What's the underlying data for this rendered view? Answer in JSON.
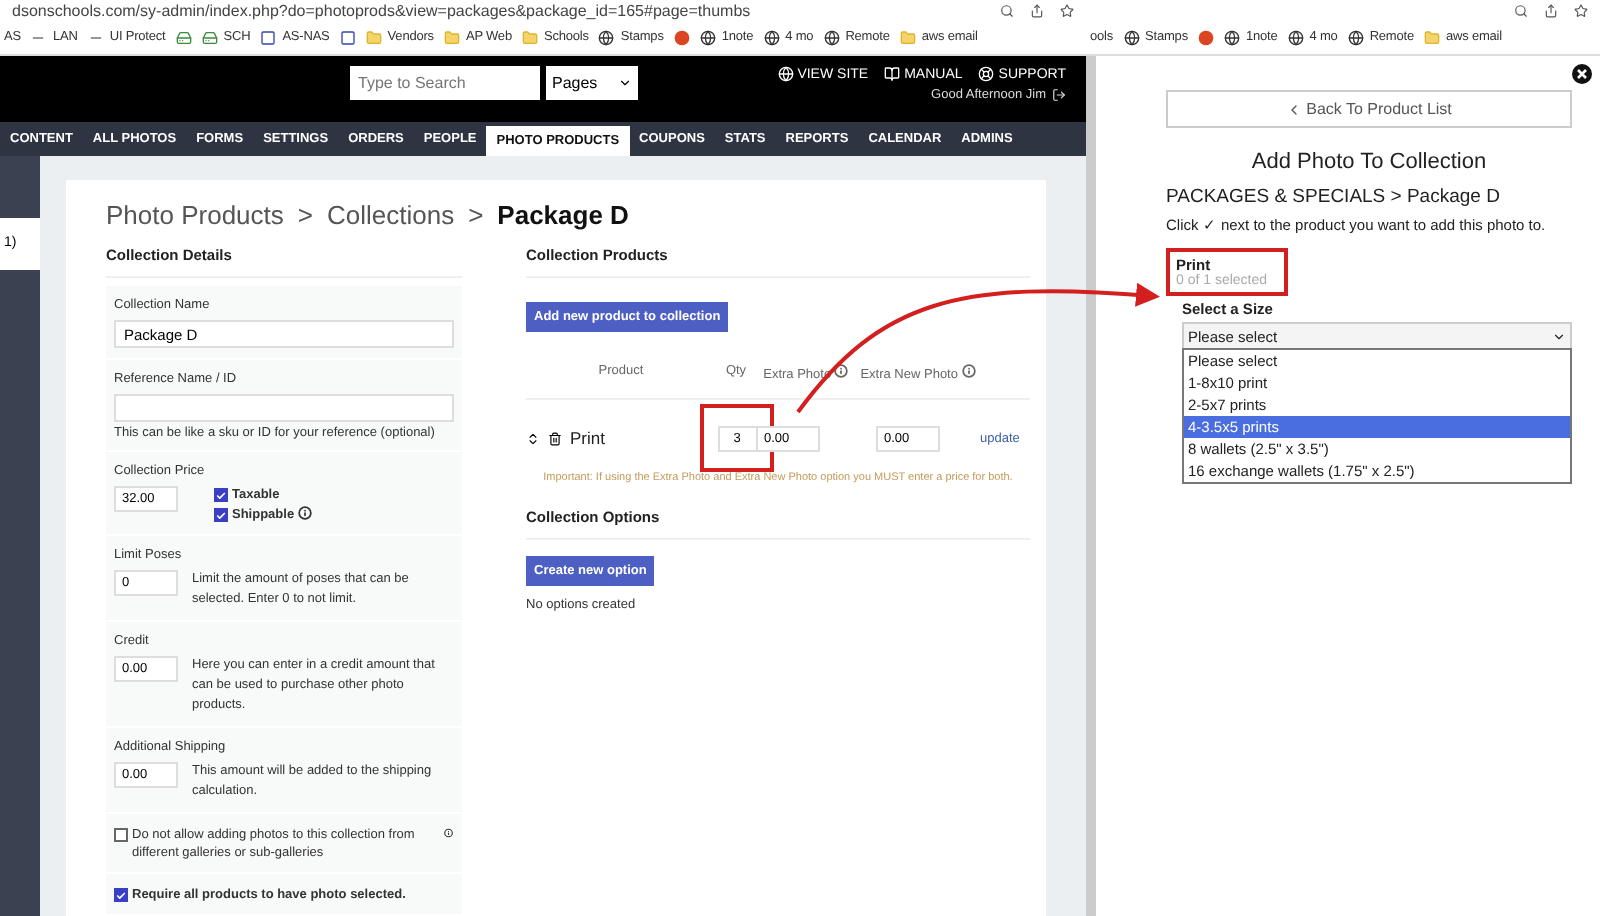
{
  "left_browser": {
    "url": "dsonschools.com/sy-admin/index.php?do=photoprods&view=packages&package_id=165#page=thumbs",
    "bookmarks": [
      {
        "kind": "plain",
        "label": "AS"
      },
      {
        "kind": "line",
        "label": "LAN"
      },
      {
        "kind": "line",
        "label": "UI Protect"
      },
      {
        "kind": "drive"
      },
      {
        "kind": "drive",
        "label": "SCH"
      },
      {
        "kind": "box",
        "label": "AS-NAS"
      },
      {
        "kind": "box"
      },
      {
        "kind": "folder",
        "label": "Vendors"
      },
      {
        "kind": "folder",
        "label": "AP Web"
      },
      {
        "kind": "folder",
        "label": "Schools"
      },
      {
        "kind": "site",
        "label": "Stamps"
      },
      {
        "kind": "dot"
      },
      {
        "kind": "site",
        "label": "1note"
      },
      {
        "kind": "site",
        "label": "4 mo"
      },
      {
        "kind": "site",
        "label": "Remote"
      },
      {
        "kind": "folder",
        "label": "aws email"
      }
    ],
    "header": {
      "search": {
        "placeholder": "Type to Search"
      },
      "scope": "Pages",
      "links": [
        {
          "kind": "globe",
          "label": "VIEW SITE"
        },
        {
          "kind": "book",
          "label": "MANUAL"
        },
        {
          "kind": "help",
          "label": "SUPPORT"
        }
      ],
      "greeting": "Good Afternoon Jim"
    },
    "nav": [
      {
        "label": "CONTENT",
        "selected": false
      },
      {
        "label": "ALL PHOTOS",
        "selected": false
      },
      {
        "label": "FORMS",
        "selected": false
      },
      {
        "label": "SETTINGS",
        "selected": false
      },
      {
        "label": "ORDERS",
        "selected": false
      },
      {
        "label": "PEOPLE",
        "selected": false
      },
      {
        "label": "PHOTO PRODUCTS",
        "selected": true
      },
      {
        "label": "COUPONS",
        "selected": false
      },
      {
        "label": "STATS",
        "selected": false
      },
      {
        "label": "REPORTS",
        "selected": false
      },
      {
        "label": "CALENDAR",
        "selected": false
      },
      {
        "label": "ADMINS",
        "selected": false
      }
    ],
    "sidebar_fragment": "1)",
    "breadcrumb": {
      "items": [
        "Photo Products",
        "Collections",
        "Package D"
      ],
      "separator": ">"
    },
    "details": {
      "title": "Collection Details",
      "fields": [
        {
          "kind": "text",
          "label": "Collection Name",
          "value": "Package D"
        },
        {
          "kind": "text",
          "label": "Reference Name / ID",
          "hint": "This can be like a sku or ID for your reference (optional)"
        },
        {
          "kind": "price",
          "label": "Collection Price",
          "value": "32.00",
          "options": [
            {
              "label": "Taxable",
              "checked": true,
              "info": false
            },
            {
              "label": "Shippable",
              "checked": true,
              "info": true
            }
          ]
        },
        {
          "kind": "note",
          "label": "Limit Poses",
          "value": "0",
          "note": "Limit the amount of poses that can be selected. Enter 0 to not limit."
        },
        {
          "kind": "note",
          "label": "Credit",
          "value": "0.00",
          "note": "Here you can enter in a credit amount that can be used to purchase other photo products."
        },
        {
          "kind": "note",
          "label": "Additional Shipping",
          "value": "0.00",
          "note": "This amount will be added to the shipping calculation."
        }
      ],
      "checks": [
        {
          "label": "Do not allow adding photos to this collection from different galleries or sub-galleries",
          "checked": false,
          "info": true,
          "emphasis": false
        },
        {
          "label": "Require all products to have photo selected.",
          "checked": true,
          "info": false,
          "emphasis": true
        }
      ]
    },
    "products": {
      "title": "Collection Products",
      "add_button": "Add new product to collection",
      "columns": [
        {
          "label": "Product",
          "info": false
        },
        {
          "label": "Qty",
          "info": false
        },
        {
          "label": "Extra Photo",
          "info": true
        },
        {
          "label": "Extra New Photo",
          "info": true
        }
      ],
      "rows": [
        {
          "name": "Print",
          "qty": "3",
          "extra_photo": "0.00",
          "extra_new_photo": "0.00",
          "action": "update"
        }
      ],
      "notice": "Important: If using the Extra Photo and Extra New Photo option you MUST enter a price for both."
    },
    "options": {
      "title": "Collection Options",
      "button": "Create new option",
      "empty": "No options created"
    }
  },
  "right_browser": {
    "bookmarks": [
      {
        "kind": "plain",
        "label": "ools"
      },
      {
        "kind": "site",
        "label": "Stamps"
      },
      {
        "kind": "dot"
      },
      {
        "kind": "site",
        "label": "1note"
      },
      {
        "kind": "site",
        "label": "4 mo"
      },
      {
        "kind": "site",
        "label": "Remote"
      },
      {
        "kind": "folder",
        "label": "aws email"
      }
    ],
    "panel": {
      "back_button": "Back To Product List",
      "title": "Add Photo To Collection",
      "crumb": "PACKAGES & SPECIALS > Package D",
      "instruction_before": "Click",
      "instruction_mark": "✓",
      "instruction_after": "next to the product you want to add this photo to.",
      "product": {
        "name": "Print",
        "count": "0 of 1 selected"
      },
      "size_label": "Select a Size",
      "size_value": "Please select",
      "size_options": [
        {
          "label": "Please select",
          "selected": false
        },
        {
          "label": "1-8x10 print",
          "selected": false
        },
        {
          "label": "2-5x7 prints",
          "selected": false
        },
        {
          "label": "4-3.5x5 prints",
          "selected": true
        },
        {
          "label": "8 wallets (2.5\" x 3.5\")",
          "selected": false
        },
        {
          "label": "16 exchange wallets (1.75\" x 2.5\")",
          "selected": false
        }
      ]
    }
  }
}
